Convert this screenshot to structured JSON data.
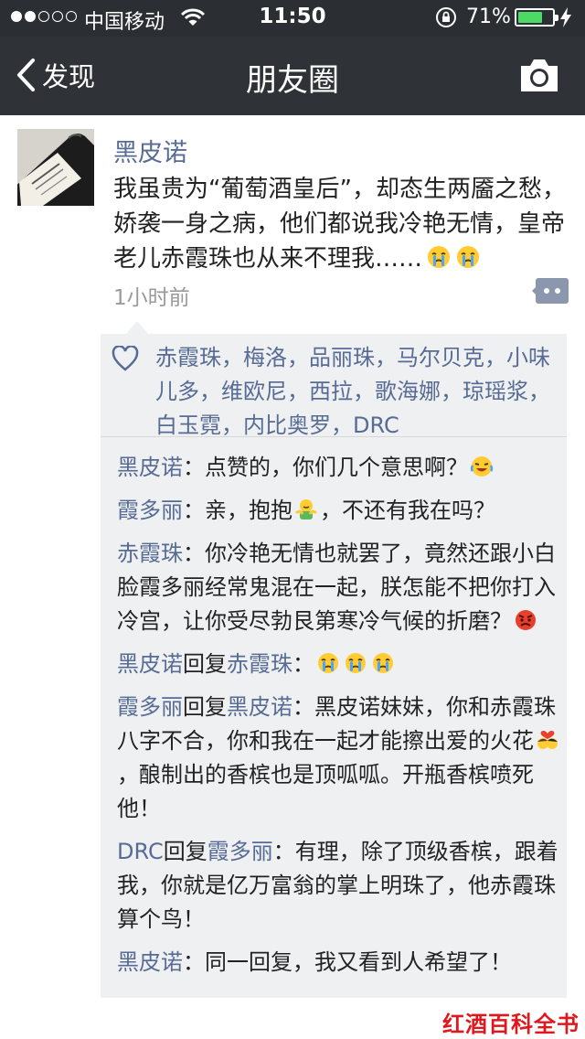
{
  "status_bar": {
    "carrier": "中国移动",
    "time": "11:50",
    "battery_percent": "71%",
    "battery_level": 0.71,
    "signal_bars": 2
  },
  "nav": {
    "back_label": "发现",
    "title": "朋友圈"
  },
  "post": {
    "author": "黑皮诺",
    "text": "我虽贵为“葡萄酒皇后”，却态生两靥之愁，娇袭一身之病，他们都说我冷艳无情，皇帝老儿赤霞珠也从来不理我……",
    "time": "1小时前"
  },
  "likes": "赤霞珠，梅洛，品丽珠，马尔贝克，小味儿多，维欧尼，西拉，歌海娜，琼瑶浆，白玉霓，内比奥罗，DRC",
  "comments": [
    {
      "author": "黑皮诺",
      "sep": "：",
      "text": "点赞的，你们几个意思啊？"
    },
    {
      "author": "霞多丽",
      "sep": "：",
      "text_a": "亲，抱抱",
      "text_b": "，不还有我在吗？"
    },
    {
      "author": "赤霞珠",
      "sep": "：",
      "text": "你冷艳无情也就罢了，竟然还跟小白脸霞多丽经常鬼混在一起，朕怎能不把你打入冷宫，让你受尽勃艮第寒冷气候的折磨？"
    },
    {
      "author": "黑皮诺",
      "reply_word": "回复",
      "target": "赤霞珠",
      "sep": "："
    },
    {
      "author": "霞多丽",
      "reply_word": "回复",
      "target": "黑皮诺",
      "sep": "：",
      "text_a": "黑皮诺妹妹，你和赤霞珠八字不合，你和我在一起才能擦出爱的火花",
      "text_b": "，酿制出的香槟也是顶呱呱。开瓶香槟喷死他！"
    },
    {
      "author": "DRC",
      "reply_word": "回复",
      "target": "霞多丽",
      "sep": "：",
      "text": "有理，除了顶级香槟，跟着我，你就是亿万富翁的掌上明珠了，他赤霞珠算个鸟！"
    },
    {
      "author": "黑皮诺",
      "sep": "：",
      "text": "同一回复，我又看到人希望了！"
    }
  ],
  "watermark": "红酒百科全书",
  "colors": {
    "nav_bg": "#2f3236",
    "name_blue": "#576b95",
    "comment_bg": "#eef0f1",
    "watermark_red": "#e0181e"
  },
  "icons": [
    "back-chevron-icon",
    "camera-icon",
    "comment-icon",
    "heart-icon",
    "crying-emoji-icon",
    "hug-emoji-icon",
    "angry-emoji-icon",
    "kissing-couple-emoji-icon"
  ]
}
